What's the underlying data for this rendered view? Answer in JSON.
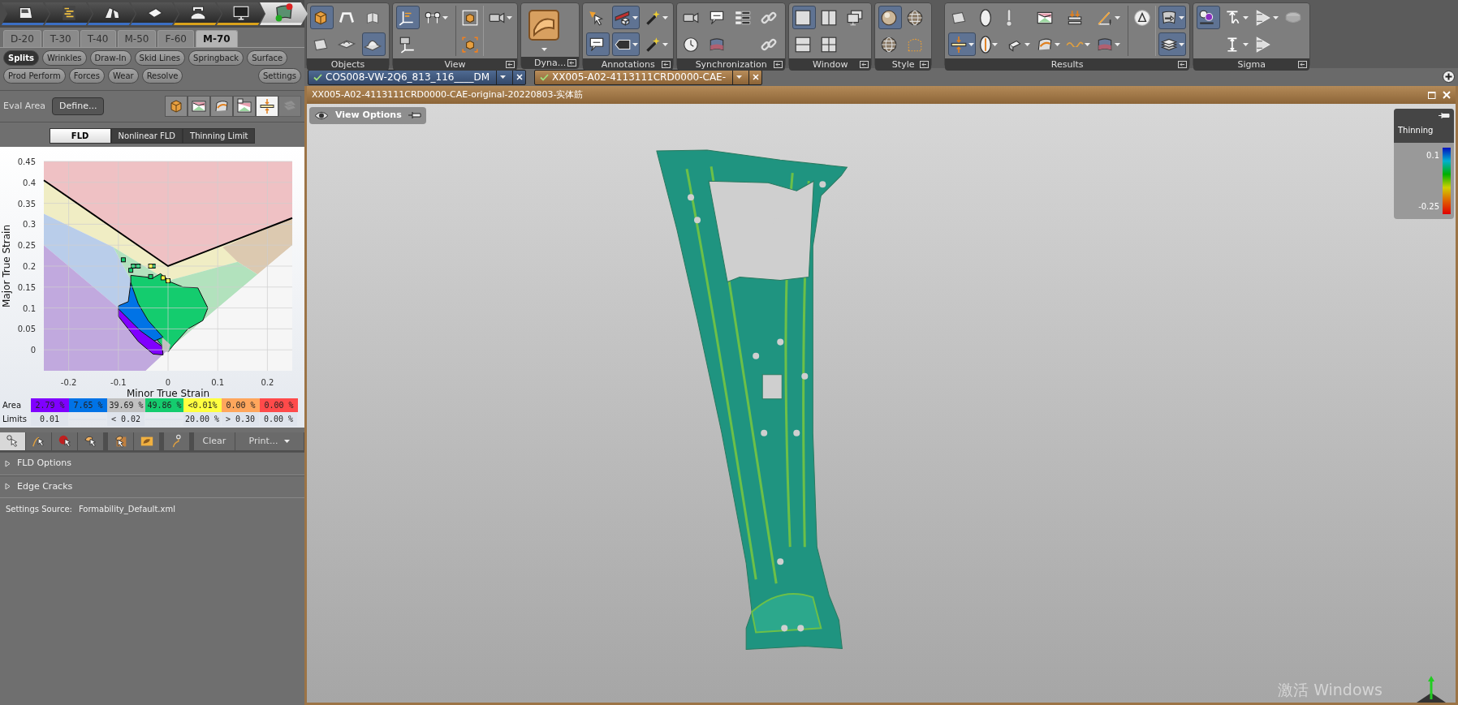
{
  "process_steps": [
    {
      "kind": "door",
      "selected": false,
      "color": "#3b6fc4"
    },
    {
      "kind": "flowchart",
      "selected": false,
      "color": "#3b6fc4"
    },
    {
      "kind": "bend",
      "selected": false,
      "color": "#3b6fc4"
    },
    {
      "kind": "plate",
      "selected": false,
      "color": "#3b6fc4"
    },
    {
      "kind": "press",
      "selected": false,
      "color": "#d9a21b"
    },
    {
      "kind": "monitor",
      "selected": false,
      "color": "#d9a21b"
    },
    {
      "kind": "report",
      "selected": true
    }
  ],
  "stage_tabs": [
    {
      "label": "D-20",
      "selected": false
    },
    {
      "label": "T-30",
      "selected": false
    },
    {
      "label": "T-40",
      "selected": false
    },
    {
      "label": "M-50",
      "selected": false
    },
    {
      "label": "F-60",
      "selected": false
    },
    {
      "label": "M-70",
      "selected": true
    }
  ],
  "mode_buttons": [
    [
      {
        "label": "Splits",
        "selected": true
      },
      {
        "label": "Wrinkles",
        "selected": false
      },
      {
        "label": "Draw-In",
        "selected": false
      },
      {
        "label": "Skid Lines",
        "selected": false
      },
      {
        "label": "Springback",
        "selected": false
      },
      {
        "label": "Surface",
        "selected": false
      }
    ],
    [
      {
        "label": "Prod Perform",
        "selected": false
      },
      {
        "label": "Forces",
        "selected": false
      },
      {
        "label": "Wear",
        "selected": false
      },
      {
        "label": "Resolve",
        "selected": false
      }
    ]
  ],
  "settings_button": "Settings",
  "eval_area": {
    "label": "Eval Area",
    "button": "Define...",
    "tools": [
      {
        "kind": "cube",
        "selected": false,
        "disabled": false
      },
      {
        "kind": "fld",
        "selected": false,
        "disabled": false
      },
      {
        "kind": "curve",
        "selected": false,
        "disabled": false
      },
      {
        "kind": "fld-swap",
        "selected": false,
        "disabled": false
      },
      {
        "kind": "thickness",
        "selected": true,
        "disabled": false
      },
      {
        "kind": "sheets",
        "selected": false,
        "disabled": true
      }
    ]
  },
  "fld_tabs": [
    {
      "label": "FLD",
      "selected": true
    },
    {
      "label": "Nonlinear FLD",
      "selected": false
    },
    {
      "label": "Thinning Limit",
      "selected": false
    }
  ],
  "chart_data": {
    "type": "line",
    "grid": true,
    "xlabel": "Minor True Strain",
    "ylabel": "Major True Strain",
    "x": [
      -0.25,
      0,
      0.25
    ],
    "series": [
      {
        "color": "#000000",
        "values": [
          0.405,
          0.2,
          0.315
        ]
      }
    ],
    "xlim": [
      -0.25,
      0.25
    ],
    "ylim": [
      -0.05,
      0.45
    ],
    "xticks": [
      -0.2,
      -0.1,
      0,
      0.1,
      0.2
    ],
    "yticks": [
      0,
      0.05,
      0.1,
      0.15,
      0.2,
      0.25,
      0.3,
      0.35,
      0.4,
      0.45
    ]
  },
  "area_row": {
    "label": "Area",
    "cells": [
      {
        "text": "2.79 %",
        "color": "#8000ff"
      },
      {
        "text": "7.65 %",
        "color": "#0073e6"
      },
      {
        "text": "39.69 %",
        "color": "#c0c0c0"
      },
      {
        "text": "49.86 %",
        "color": "#14cc6e"
      },
      {
        "text": "<0.01%",
        "color": "#ffff40"
      },
      {
        "text": "0.00 %",
        "color": "#ffa65c"
      },
      {
        "text": "0.00 %",
        "color": "#ff4a4a"
      }
    ]
  },
  "limits_row": {
    "label": "Limits",
    "cells": [
      "0.01",
      "< 0.02",
      "20.00 %",
      "> 0.30",
      "0.00 %"
    ]
  },
  "bottom_tools": {
    "tools": [
      {
        "kind": "pick-cursor",
        "selected": true
      },
      {
        "kind": "path-cursor",
        "selected": false
      },
      {
        "kind": "dot-cursor",
        "selected": false
      },
      {
        "kind": "blob-cursor",
        "selected": false
      },
      {
        "kind": "multi-cursor",
        "selected": false
      },
      {
        "kind": "blob",
        "selected": false
      },
      {
        "kind": "probe",
        "selected": false
      }
    ],
    "clear": "Clear",
    "print": "Print..."
  },
  "sections": [
    {
      "label": "FLD Options",
      "expanded": false
    },
    {
      "label": "Edge Cracks",
      "expanded": false
    }
  ],
  "settings_source": {
    "label": "Settings Source:",
    "value": "Formability_Default.xml"
  },
  "toolbar": [
    {
      "label": "Objects",
      "launcher": false,
      "columns": [
        {
          "separator": false,
          "tools": [
            {
              "kind": "cube",
              "selected": true,
              "dropdown": false
            },
            {
              "kind": "sheet",
              "selected": false,
              "dropdown": false
            }
          ]
        },
        {
          "separator": false,
          "tools": [
            {
              "kind": "arch",
              "selected": false,
              "dropdown": false
            },
            {
              "kind": "bump",
              "selected": false,
              "dropdown": false
            }
          ]
        },
        {
          "separator": false,
          "tools": [
            {
              "kind": "book",
              "selected": false,
              "dropdown": false
            },
            {
              "kind": "dome",
              "selected": true,
              "dropdown": false
            }
          ]
        }
      ]
    },
    {
      "label": "View",
      "launcher": true,
      "columns": [
        {
          "separator": false,
          "tools": [
            {
              "kind": "axes",
              "selected": true,
              "dropdown": false
            },
            {
              "kind": "axes2",
              "selected": false,
              "dropdown": false
            }
          ]
        },
        {
          "separator": false,
          "tools": [
            {
              "kind": "nodes",
              "selected": false,
              "dropdown": true
            }
          ]
        },
        {
          "separator": true,
          "tools": [
            {
              "kind": "frame-cube",
              "selected": false,
              "dropdown": false
            },
            {
              "kind": "corner-cube",
              "selected": false,
              "dropdown": false
            }
          ]
        },
        {
          "separator": false,
          "tools": [
            {
              "kind": "camera",
              "selected": false,
              "dropdown": true
            }
          ]
        }
      ]
    },
    {
      "label": "Dyna...",
      "launcher": true,
      "columns": [
        {
          "separator": false,
          "tools": [
            {
              "kind": "surface",
              "selected": false,
              "dropdown": true
            }
          ]
        }
      ]
    },
    {
      "label": "Annotations",
      "launcher": true,
      "columns": [
        {
          "separator": false,
          "tools": [
            {
              "kind": "cursor",
              "selected": false,
              "dropdown": false
            },
            {
              "kind": "label",
              "selected": true,
              "dropdown": false
            }
          ]
        },
        {
          "separator": false,
          "tools": [
            {
              "kind": "ruler",
              "selected": true,
              "dropdown": true
            },
            {
              "kind": "tag",
              "selected": true,
              "dropdown": true
            }
          ]
        },
        {
          "separator": false,
          "tools": [
            {
              "kind": "wand",
              "selected": false,
              "dropdown": true
            },
            {
              "kind": "wand",
              "selected": false,
              "dropdown": true
            }
          ]
        }
      ]
    },
    {
      "label": "Synchronization",
      "launcher": true,
      "columns": [
        {
          "separator": false,
          "tools": [
            {
              "kind": "camera",
              "selected": false,
              "dropdown": false
            },
            {
              "kind": "clock",
              "selected": false,
              "dropdown": false
            }
          ]
        },
        {
          "separator": false,
          "tools": [
            {
              "kind": "label",
              "selected": false,
              "dropdown": false
            },
            {
              "kind": "gradient",
              "selected": false,
              "dropdown": false
            }
          ]
        },
        {
          "separator": false,
          "tools": [
            {
              "kind": "list",
              "selected": false,
              "dropdown": false
            }
          ]
        },
        {
          "separator": false,
          "tools": [
            {
              "kind": "link",
              "selected": false,
              "dropdown": false
            },
            {
              "kind": "link",
              "selected": false,
              "dropdown": false
            }
          ]
        }
      ]
    },
    {
      "label": "Window",
      "launcher": true,
      "columns": [
        {
          "separator": false,
          "tools": [
            {
              "kind": "pane-single",
              "selected": true,
              "dropdown": false
            },
            {
              "kind": "pane-h",
              "selected": false,
              "dropdown": false
            }
          ]
        },
        {
          "separator": false,
          "tools": [
            {
              "kind": "pane-v",
              "selected": false,
              "dropdown": false
            },
            {
              "kind": "pane-quad",
              "selected": false,
              "dropdown": false
            }
          ]
        },
        {
          "separator": false,
          "tools": [
            {
              "kind": "screens",
              "selected": false,
              "dropdown": false
            }
          ]
        }
      ]
    },
    {
      "label": "Style",
      "launcher": true,
      "columns": [
        {
          "separator": false,
          "tools": [
            {
              "kind": "sphere",
              "selected": true,
              "dropdown": false
            },
            {
              "kind": "globe",
              "selected": false,
              "dropdown": false
            }
          ]
        },
        {
          "separator": false,
          "tools": [
            {
              "kind": "globe",
              "selected": false,
              "dropdown": false
            },
            {
              "kind": "dotted",
              "selected": false,
              "dropdown": false
            }
          ]
        }
      ]
    },
    {
      "label": "Results",
      "launcher": true,
      "columns": [
        {
          "separator": false,
          "tools": [
            {
              "kind": "sheet",
              "selected": false,
              "dropdown": false
            },
            {
              "kind": "thickness",
              "selected": true,
              "dropdown": true
            }
          ]
        },
        {
          "separator": false,
          "tools": [
            {
              "kind": "ellipse",
              "selected": false,
              "dropdown": false
            },
            {
              "kind": "ellipse-v",
              "selected": false,
              "dropdown": true
            }
          ]
        },
        {
          "separator": false,
          "tools": [
            {
              "kind": "thermo",
              "selected": false,
              "dropdown": false
            },
            {
              "kind": "eraser",
              "selected": false,
              "dropdown": true
            }
          ]
        },
        {
          "separator": false,
          "tools": [
            {
              "kind": "fld",
              "selected": false,
              "dropdown": false
            },
            {
              "kind": "curve",
              "selected": false,
              "dropdown": true
            }
          ]
        },
        {
          "separator": false,
          "tools": [
            {
              "kind": "stack",
              "selected": false,
              "dropdown": false
            },
            {
              "kind": "wave",
              "selected": false,
              "dropdown": true
            }
          ]
        },
        {
          "separator": false,
          "tools": [
            {
              "kind": "angle",
              "selected": false,
              "dropdown": true
            },
            {
              "kind": "gradient",
              "selected": false,
              "dropdown": true
            }
          ]
        },
        {
          "separator": true,
          "tools": [
            {
              "kind": "delta",
              "selected": false,
              "dropdown": false
            }
          ]
        },
        {
          "separator": false,
          "tools": [
            {
              "kind": "card",
              "selected": true,
              "dropdown": true
            },
            {
              "kind": "layers",
              "selected": true,
              "dropdown": true
            }
          ]
        }
      ]
    },
    {
      "label": "Sigma",
      "launcher": true,
      "columns": [
        {
          "separator": false,
          "tools": [
            {
              "kind": "dots",
              "selected": true,
              "dropdown": false
            }
          ]
        },
        {
          "separator": false,
          "tools": [
            {
              "kind": "peak",
              "selected": false,
              "dropdown": true
            },
            {
              "kind": "height",
              "selected": false,
              "dropdown": true
            }
          ]
        },
        {
          "separator": false,
          "tools": [
            {
              "kind": "cone",
              "selected": false,
              "dropdown": true
            },
            {
              "kind": "cone",
              "selected": false,
              "dropdown": false
            }
          ]
        },
        {
          "separator": false,
          "tools": [
            {
              "kind": "disc",
              "selected": false,
              "dropdown": false
            }
          ]
        }
      ]
    }
  ],
  "documents": [
    {
      "title": "COS008-VW-2Q6_813_116____DM",
      "selected": false,
      "checked": true
    },
    {
      "title": "XX005-A02-4113111CRD0000-CAE-",
      "selected": true,
      "checked": true
    }
  ],
  "document_window": {
    "title": "XX005-A02-4113111CRD0000-CAE-original-20220803-实体筋",
    "view_options": "View Options",
    "legend": {
      "title": "Thinning",
      "max": "0.1",
      "min": "-0.25"
    }
  },
  "os_notice": "激活 Windows"
}
